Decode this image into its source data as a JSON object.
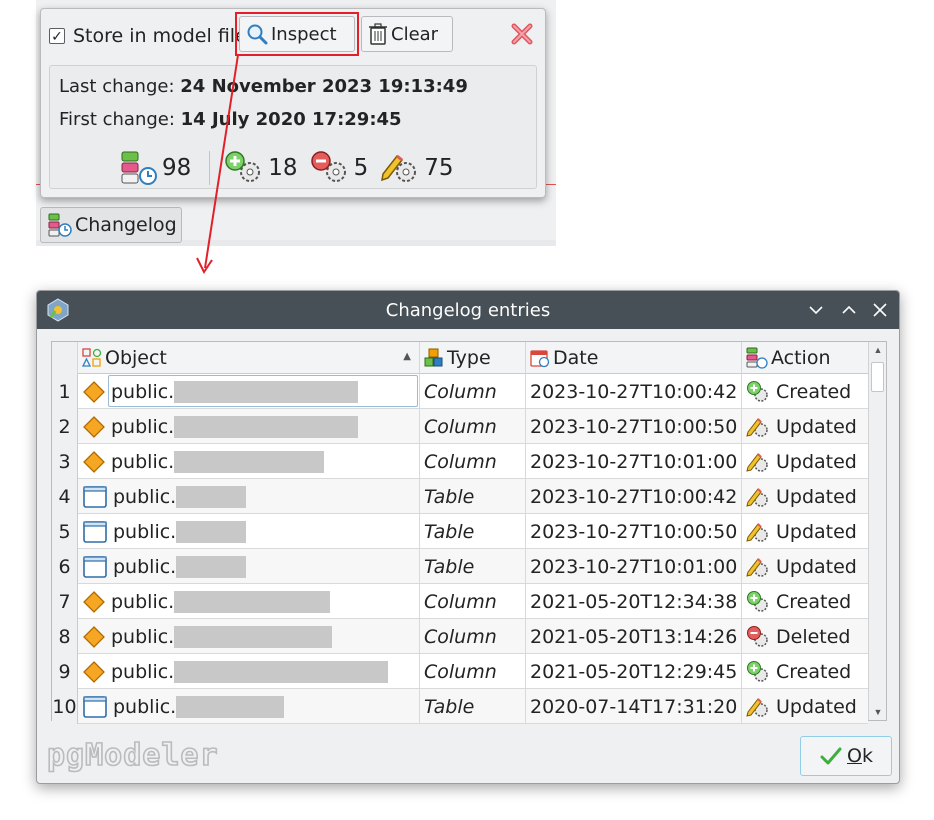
{
  "popup": {
    "store_checkbox_mark": "✓",
    "store_label": "Store in model file",
    "inspect_label": "Inspect",
    "clear_label": "Clear",
    "last_change_label": "Last change:",
    "last_change_value": "24 November 2023 19:13:49",
    "first_change_label": "First change:",
    "first_change_value": "14 July 2020 17:29:45",
    "stats": {
      "total": "98",
      "created": "18",
      "deleted": "5",
      "updated": "75"
    }
  },
  "changelog_button_label": "Changelog",
  "dialog": {
    "title": "Changelog entries",
    "columns": {
      "object": "Object",
      "type": "Type",
      "date": "Date",
      "action": "Action"
    },
    "rows": [
      {
        "num": "1",
        "object": "public.",
        "obj_kind": "column",
        "type": "Column",
        "date": "2023-10-27T10:00:42",
        "action": "Created"
      },
      {
        "num": "2",
        "object": "public.",
        "obj_kind": "column",
        "type": "Column",
        "date": "2023-10-27T10:00:50",
        "action": "Updated"
      },
      {
        "num": "3",
        "object": "public.",
        "obj_kind": "column",
        "type": "Column",
        "date": "2023-10-27T10:01:00",
        "action": "Updated"
      },
      {
        "num": "4",
        "object": "public.",
        "obj_kind": "table",
        "type": "Table",
        "date": "2023-10-27T10:00:42",
        "action": "Updated"
      },
      {
        "num": "5",
        "object": "public.",
        "obj_kind": "table",
        "type": "Table",
        "date": "2023-10-27T10:00:50",
        "action": "Updated"
      },
      {
        "num": "6",
        "object": "public.",
        "obj_kind": "table",
        "type": "Table",
        "date": "2023-10-27T10:01:00",
        "action": "Updated"
      },
      {
        "num": "7",
        "object": "public.",
        "obj_kind": "column",
        "type": "Column",
        "date": "2021-05-20T12:34:38",
        "action": "Created"
      },
      {
        "num": "8",
        "object": "public.",
        "obj_kind": "column",
        "type": "Column",
        "date": "2021-05-20T13:14:26",
        "action": "Deleted"
      },
      {
        "num": "9",
        "object": "public.",
        "obj_kind": "column",
        "type": "Column",
        "date": "2021-05-20T12:29:45",
        "action": "Created"
      },
      {
        "num": "10",
        "object": "public.",
        "obj_kind": "table",
        "type": "Table",
        "date": "2020-07-14T17:31:20",
        "action": "Updated"
      }
    ],
    "ok_label": "Ok",
    "ok_mnemonic": "O",
    "ok_rest": "k"
  },
  "logo_text": "pgModeler",
  "colors": {
    "titlebar": "#475057",
    "highlight_red": "#e3202a",
    "column_icon": "#f5a623",
    "create_green": "#3fae3f",
    "delete_red": "#d9463c",
    "update_yellow": "#f2c12e"
  }
}
